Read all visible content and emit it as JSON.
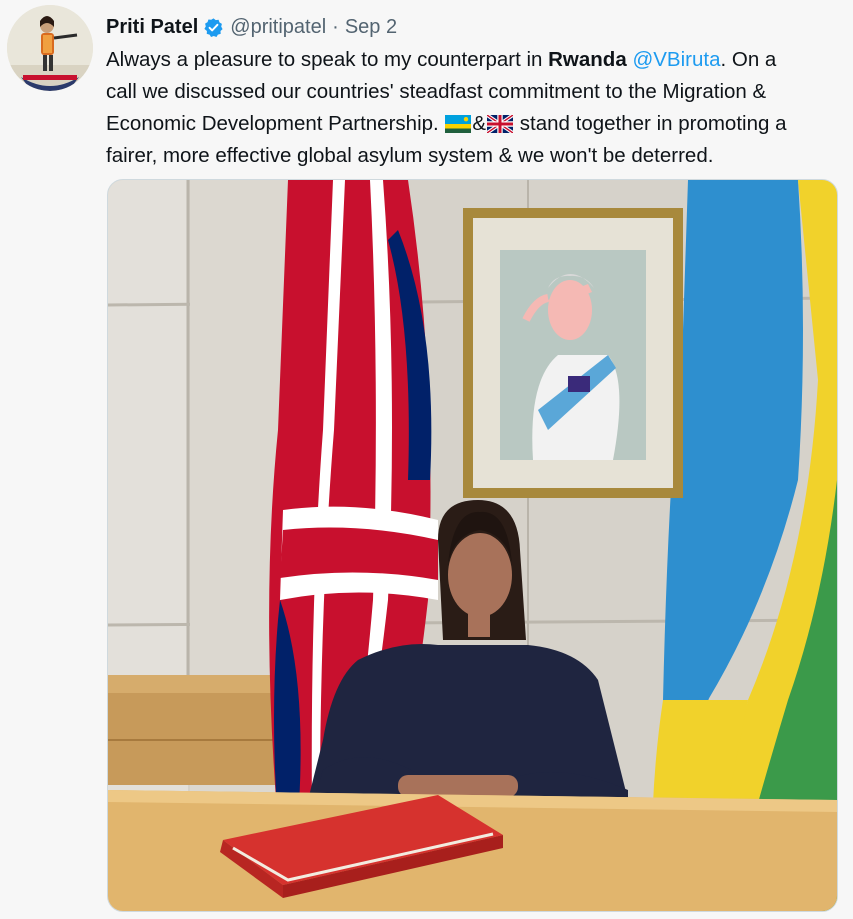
{
  "author": {
    "name": "Priti Patel",
    "handle": "@pritipatel",
    "separator": "·",
    "date": "Sep 2",
    "verified": true
  },
  "tweet": {
    "line1_pre": "Always a pleasure to speak to my counterpart in ",
    "line1_bold": "Rwanda",
    "line1_mention": "@VBiruta",
    "line1_post": ". On a",
    "line2": "call we discussed our countries' steadfast commitment to the Migration &",
    "line3_pre": "Economic Development Partnership. ",
    "line3_amp": "&",
    "line3_post": " stand together in promoting a",
    "line4": "fairer, more effective global asylum system & we won't be deterred."
  },
  "colors": {
    "mention": "#1d9bf0",
    "verified_badge": "#1d9bf0",
    "secondary_text": "#536471"
  },
  "icons": {
    "verified": "verified-badge-icon",
    "flag_rwanda": "rwanda-flag-emoji",
    "flag_uk": "uk-flag-emoji"
  }
}
